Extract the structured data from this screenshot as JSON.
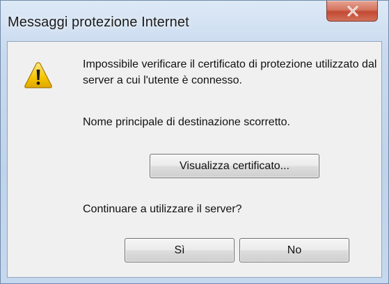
{
  "window": {
    "title": "Messaggi protezione Internet",
    "close_icon": "close-x-icon"
  },
  "dialog": {
    "icon": "warning-icon",
    "message_line1": "Impossibile verificare il certificato di protezione utilizzato dal server a cui l'utente è connesso.",
    "message_line2": "Nome principale di destinazione scorretto.",
    "question": "Continuare a utilizzare il server?"
  },
  "buttons": {
    "view_certificate": "Visualizza certificato...",
    "yes": "Sì",
    "no": "No"
  },
  "colors": {
    "frame": "#c9daef",
    "client_background": "#f0f0f0",
    "close_button": "#c24a33",
    "warning_yellow": "#f5c400"
  }
}
